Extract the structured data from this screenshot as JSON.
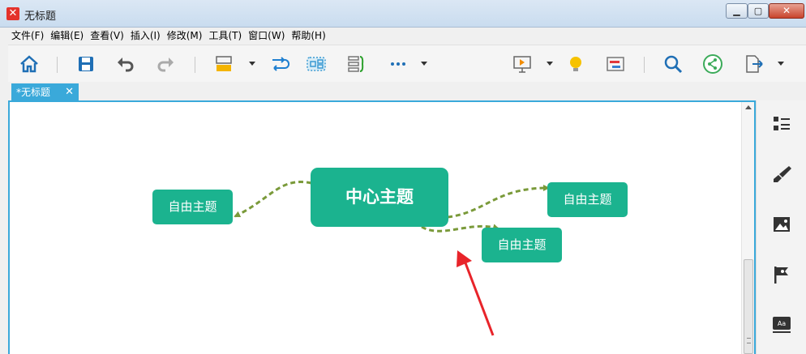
{
  "window": {
    "title": "无标题"
  },
  "menu": {
    "items": [
      "文件(F)",
      "编辑(E)",
      "查看(V)",
      "插入(I)",
      "修改(M)",
      "工具(T)",
      "窗口(W)",
      "帮助(H)"
    ]
  },
  "toolbar": {
    "icons": [
      "home-icon",
      "save-icon",
      "undo-icon",
      "redo-icon",
      "insert-topic-icon",
      "relationship-icon",
      "boundary-icon",
      "summary-icon",
      "more-icon",
      "presentation-icon",
      "idea-icon",
      "gantt-icon",
      "search-icon",
      "share-icon",
      "export-icon"
    ]
  },
  "tab": {
    "label": "*无标题",
    "close": "✕"
  },
  "mindmap": {
    "central_topic": "中心主题",
    "floating_topics": [
      "自由主题",
      "自由主题",
      "自由主题"
    ],
    "node_color": "#1bb38f",
    "connector_color": "#7a9a3a",
    "annotation_arrow_color": "#e8242a"
  },
  "sidebar": {
    "icons": [
      "outline-icon",
      "format-brush-icon",
      "image-icon",
      "marker-flag-icon",
      "text-style-icon"
    ]
  }
}
